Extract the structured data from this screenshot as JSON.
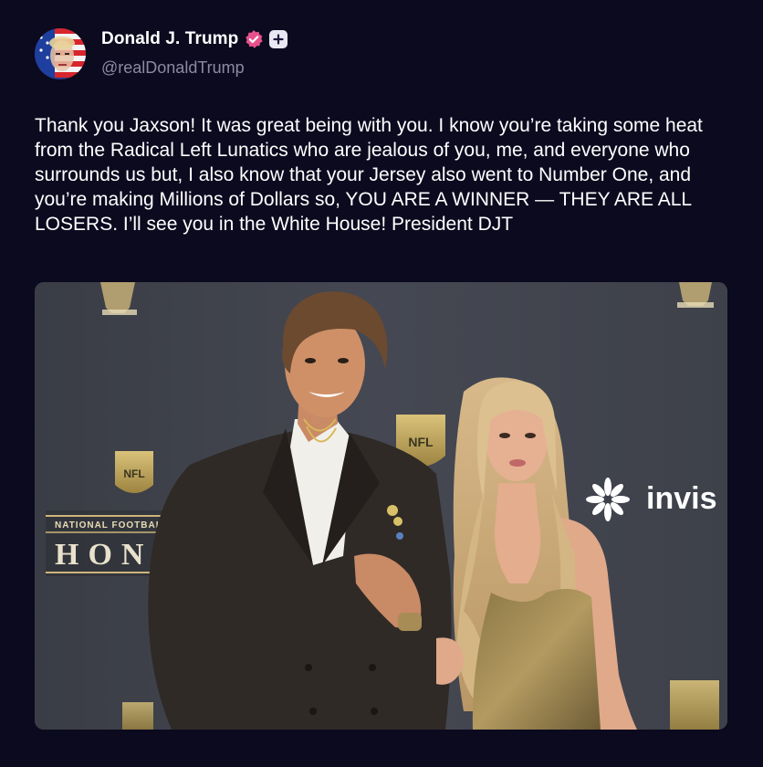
{
  "author": {
    "display_name": "Donald J. Trump",
    "handle": "@realDonaldTrump",
    "avatar_icon": "avatar-flag-portrait",
    "verified_icon": "verified-badge-icon",
    "verified_color": "#e8528c",
    "plus_icon": "plus-badge-icon"
  },
  "post": {
    "text": "Thank you Jaxson! It was great being with you. I know you’re taking some heat from the Radical Left Lunatics who are jealous of you, me, and everyone who surrounds us but, I also know that your Jersey also went to Number One, and you’re making Millions of Dollars so, YOU ARE A WINNER — THEY ARE ALL LOSERS. I’ll see you in the White House! President DJT"
  },
  "media": {
    "type": "photo",
    "backdrop_text_honors_top": "NATIONAL FOOTBALL",
    "backdrop_text_honors": "HONO",
    "backdrop_logo_text": "NFL",
    "sponsor_text": "invis"
  },
  "colors": {
    "background": "#0c0a1f",
    "text": "#ffffff",
    "handle": "#8b8aa1"
  }
}
